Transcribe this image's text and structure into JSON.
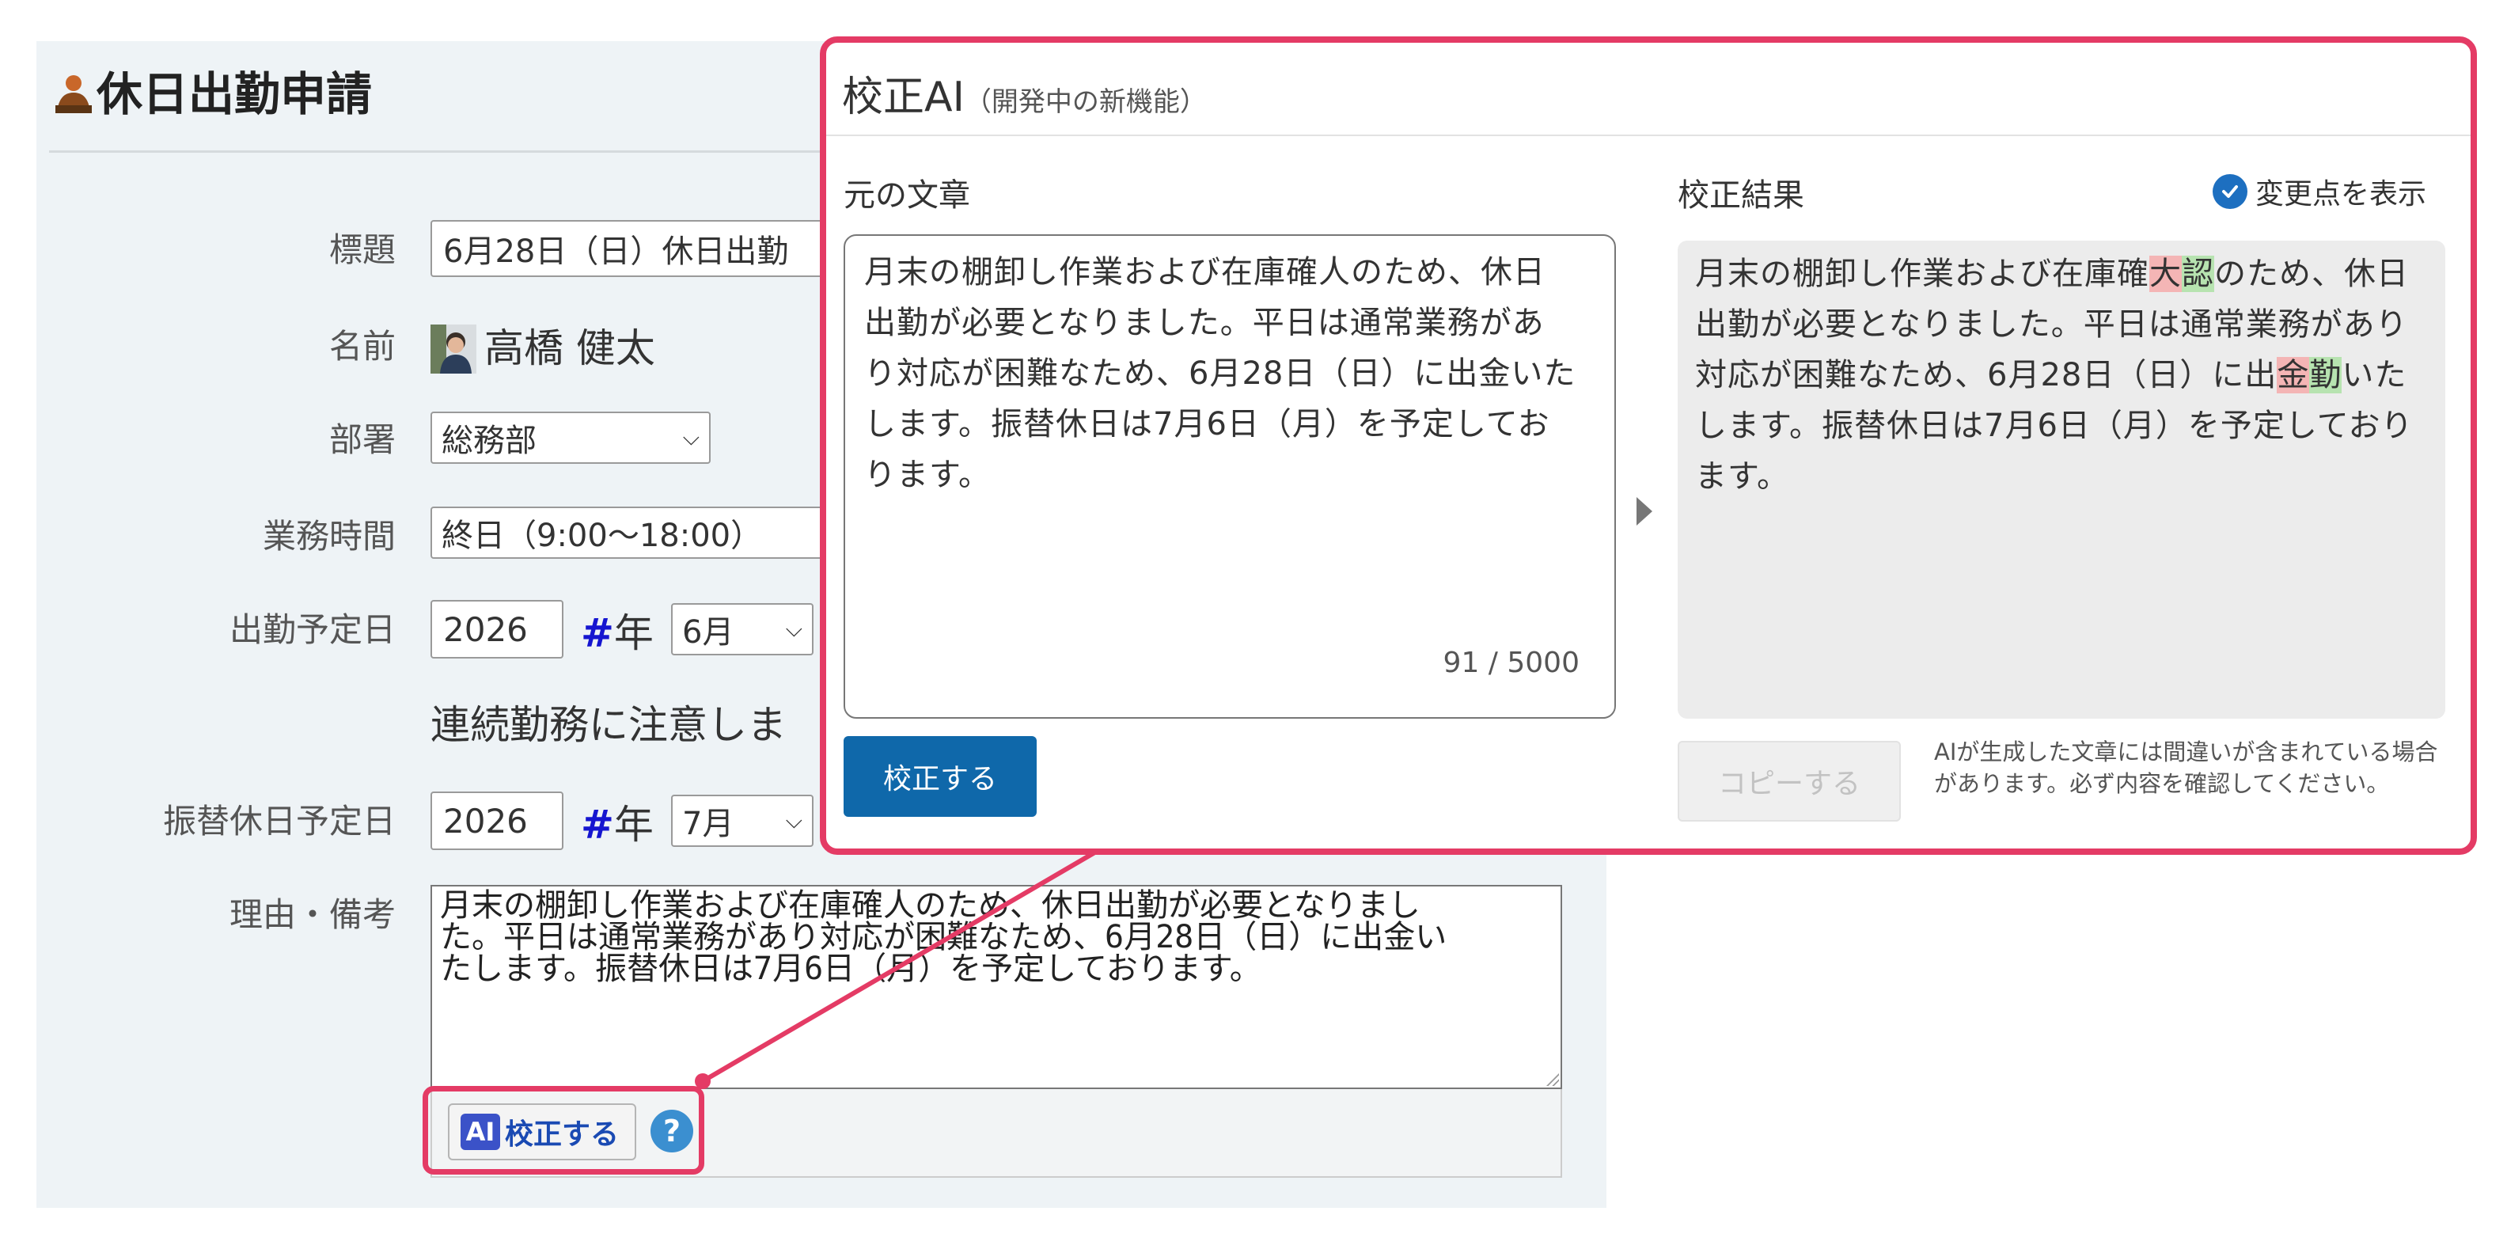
{
  "form": {
    "title": "休日出勤申請",
    "fields": {
      "subject_label": "標題",
      "subject_value": "6月28日（日）休日出勤",
      "name_label": "名前",
      "name_value": "高橋 健太",
      "dept_label": "部署",
      "dept_value": "総務部",
      "hours_label": "業務時間",
      "hours_value": "終日（9:00〜18:00）",
      "workdate_label": "出勤予定日",
      "workdate_year": "2026",
      "workdate_hash": "#",
      "workdate_year_suffix": "年",
      "workdate_month": "6月",
      "warning_text": "連続勤務に注意しま",
      "subdate_label": "振替休日予定日",
      "subdate_year": "2026",
      "subdate_hash": "#",
      "subdate_year_suffix": "年",
      "subdate_month": "7月",
      "reason_label": "理由・備考",
      "reason_lines": [
        "月末の棚卸し作業および在庫確人のため、休日出勤が必要となりまし",
        "た。平日は通常業務があり対応が困難なため、6月28日（日）に出金い",
        "たします。振替休日は7月6日（月）を予定しております。"
      ]
    },
    "ai_button": {
      "badge": "AI",
      "label": "校正する",
      "help": "?"
    }
  },
  "popup": {
    "title": "校正AI",
    "subtitle": "（開発中の新機能）",
    "original_label": "元の文章",
    "original_text": "月末の棚卸し作業および在庫確人のため、休日出勤が必要となりました。平日は通常業務があり対応が困難なため、6月28日（日）に出金いたします。振替休日は7月6日（月）を予定しております。",
    "counter": "91 / 5000",
    "proofread_button": "校正する",
    "result_label": "校正結果",
    "show_changes_label": "変更点を表示",
    "result": {
      "seg1": "月末の棚卸し作業および在庫確",
      "del1": "大",
      "ins1": "認",
      "seg2": "のため、休日出勤が必要となりました。平日は通常業務があり対応が困難なため、6月28日（日）に出",
      "del2": "金",
      "ins2": "勤",
      "seg3": "いたします。振替休日は7月6日（月）を予定しております。"
    },
    "copy_button": "コピーする",
    "disclaimer": "AIが生成した文章には間違いが含まれている場合があります。必ず内容を確認してください。"
  },
  "colors": {
    "highlight": "#e43b65",
    "primary_button": "#0f68aa",
    "deletion": "#f4b5b5",
    "insertion": "#b7e3b0"
  },
  "icons": [
    "person-icon",
    "avatar",
    "chevron-down-icon",
    "help-icon",
    "check-icon",
    "arrow-right-icon",
    "ai-badge-icon"
  ]
}
